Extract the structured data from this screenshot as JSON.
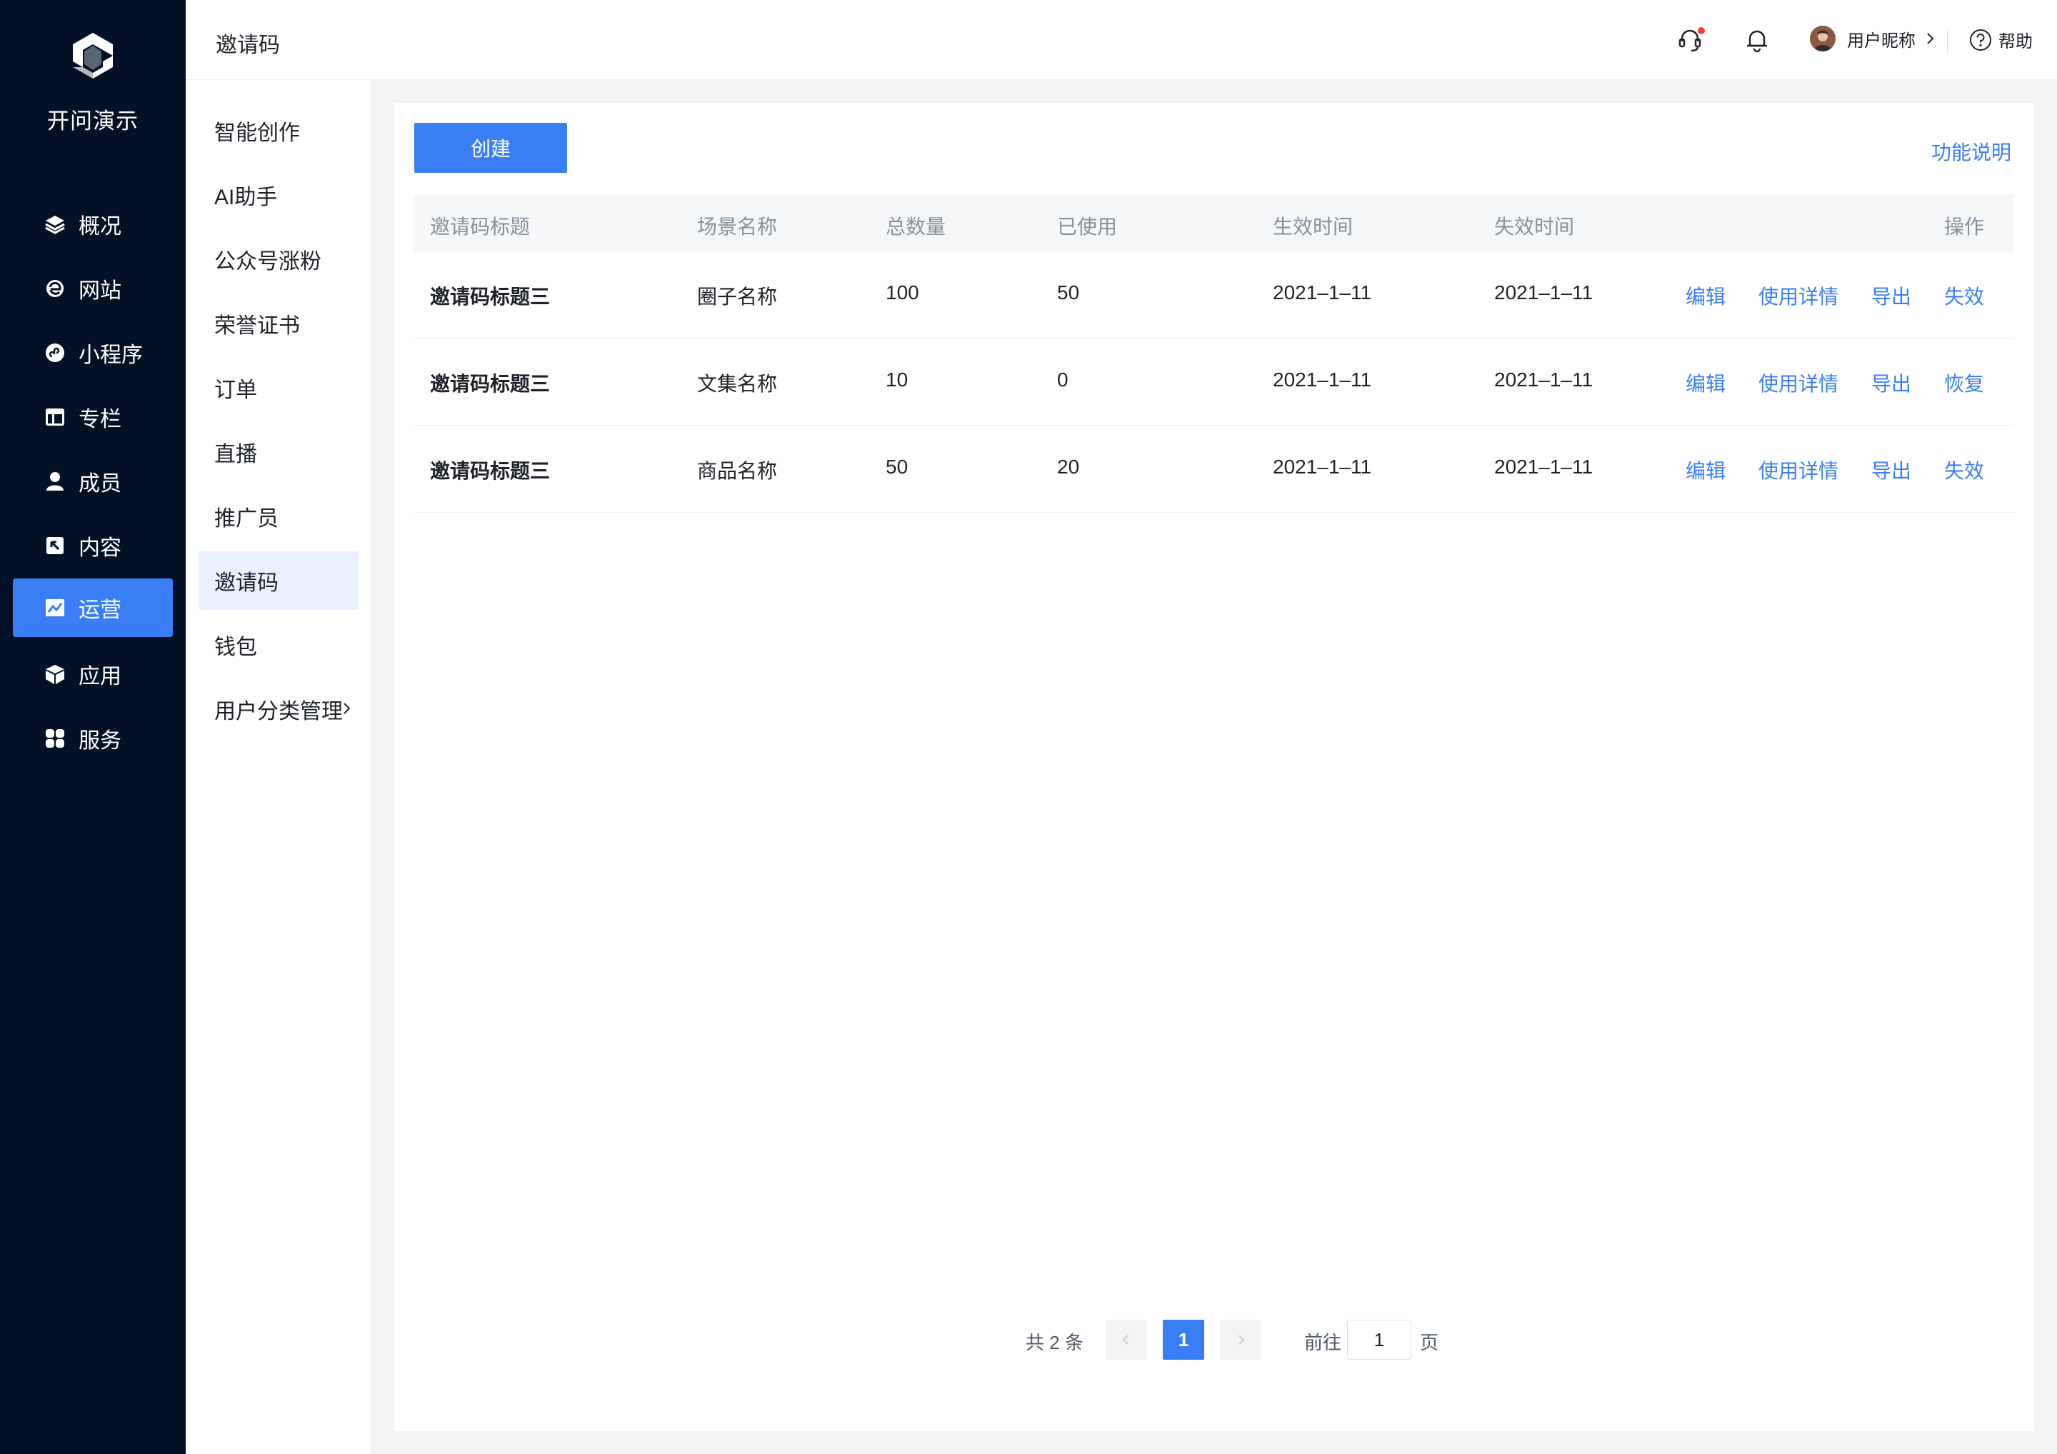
{
  "brand": {
    "name": "开问演示"
  },
  "nav": [
    {
      "label": "概况",
      "icon": "layers-icon"
    },
    {
      "label": "网站",
      "icon": "ie-browser-icon"
    },
    {
      "label": "小程序",
      "icon": "mini-program-icon"
    },
    {
      "label": "专栏",
      "icon": "column-layout-icon"
    },
    {
      "label": "成员",
      "icon": "person-icon"
    },
    {
      "label": "内容",
      "icon": "content-icon"
    },
    {
      "label": "运营",
      "icon": "trend-chart-icon",
      "active": true
    },
    {
      "label": "应用",
      "icon": "cube-icon"
    },
    {
      "label": "服务",
      "icon": "grid-apps-icon"
    }
  ],
  "submenu": [
    {
      "label": "智能创作"
    },
    {
      "label": "AI助手"
    },
    {
      "label": "公众号涨粉"
    },
    {
      "label": "荣誉证书"
    },
    {
      "label": "订单"
    },
    {
      "label": "直播"
    },
    {
      "label": "推广员"
    },
    {
      "label": "邀请码",
      "active": true
    },
    {
      "label": "钱包"
    },
    {
      "label": "用户分类管理",
      "has_arrow": true
    }
  ],
  "header": {
    "title": "邀请码",
    "user_name": "用户昵称",
    "help_label": "帮助"
  },
  "toolbar": {
    "create_label": "创建",
    "func_desc_label": "功能说明"
  },
  "table": {
    "columns": [
      "邀请码标题",
      "场景名称",
      "总数量",
      "已使用",
      "生效时间",
      "失效时间",
      "操作"
    ],
    "rows": [
      {
        "title": "邀请码标题三",
        "scene": "圈子名称",
        "total": "100",
        "used": "50",
        "start": "2021–1–11",
        "end": "2021–1–11",
        "actions": [
          "编辑",
          "使用详情",
          "导出",
          "失效"
        ]
      },
      {
        "title": "邀请码标题三",
        "scene": "文集名称",
        "total": "10",
        "used": "0",
        "start": "2021–1–11",
        "end": "2021–1–11",
        "actions": [
          "编辑",
          "使用详情",
          "导出",
          "恢复"
        ]
      },
      {
        "title": "邀请码标题三",
        "scene": "商品名称",
        "total": "50",
        "used": "20",
        "start": "2021–1–11",
        "end": "2021–1–11",
        "actions": [
          "编辑",
          "使用详情",
          "导出",
          "失效"
        ]
      }
    ]
  },
  "pagination": {
    "total_text": "共 2 条",
    "current_page": "1",
    "goto_label": "前往",
    "goto_value": "1",
    "page_suffix": "页"
  },
  "colors": {
    "nav_bg": "#031127",
    "accent": "#3a7ef6",
    "sub_active_bg": "#eaf1fe",
    "notification_dot": "#f53f3f"
  }
}
